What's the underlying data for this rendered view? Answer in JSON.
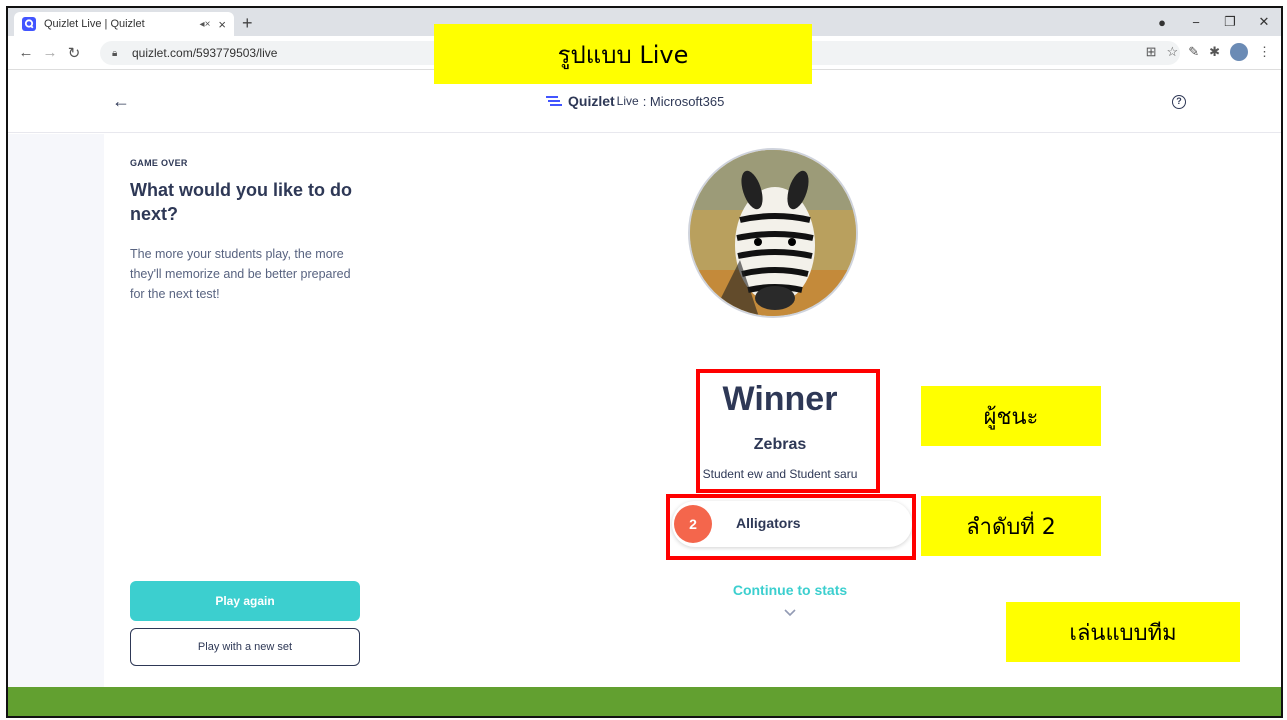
{
  "browser": {
    "tab_title": "Quizlet Live | Quizlet",
    "tab_mute_icon": "speaker-muted-icon",
    "tab_close": "×",
    "new_tab": "+",
    "url": "quizlet.com/593779503/live",
    "window_controls": [
      "●",
      "−",
      "❐",
      "✕"
    ]
  },
  "header": {
    "brand_name": "Quizlet",
    "brand_live": "Live",
    "set_name": ": Microsoft365",
    "help": "?"
  },
  "left_panel": {
    "label": "GAME OVER",
    "title": "What would you like to do next?",
    "description": "The more your students play, the more they'll memorize and be better prepared for the next test!",
    "play_again": "Play again",
    "play_new_set": "Play with a new set"
  },
  "result": {
    "winner_label": "Winner",
    "winner_team": "Zebras",
    "winner_members": "Student ew and Student saru",
    "runner_rank": "2",
    "runner_team": "Alligators",
    "continue_label": "Continue to stats"
  },
  "annotations": {
    "live_format": "รูปแบบ Live",
    "winner": "ผู้ชนะ",
    "second_place": "ลำดับที่ 2",
    "team_play": "เล่นแบบทีม"
  },
  "colors": {
    "accent": "#3ccfcf",
    "rank_badge": "#f4664c",
    "footer_green": "#62a030",
    "highlight": "#ffff00",
    "outline_red": "#ff0000"
  }
}
